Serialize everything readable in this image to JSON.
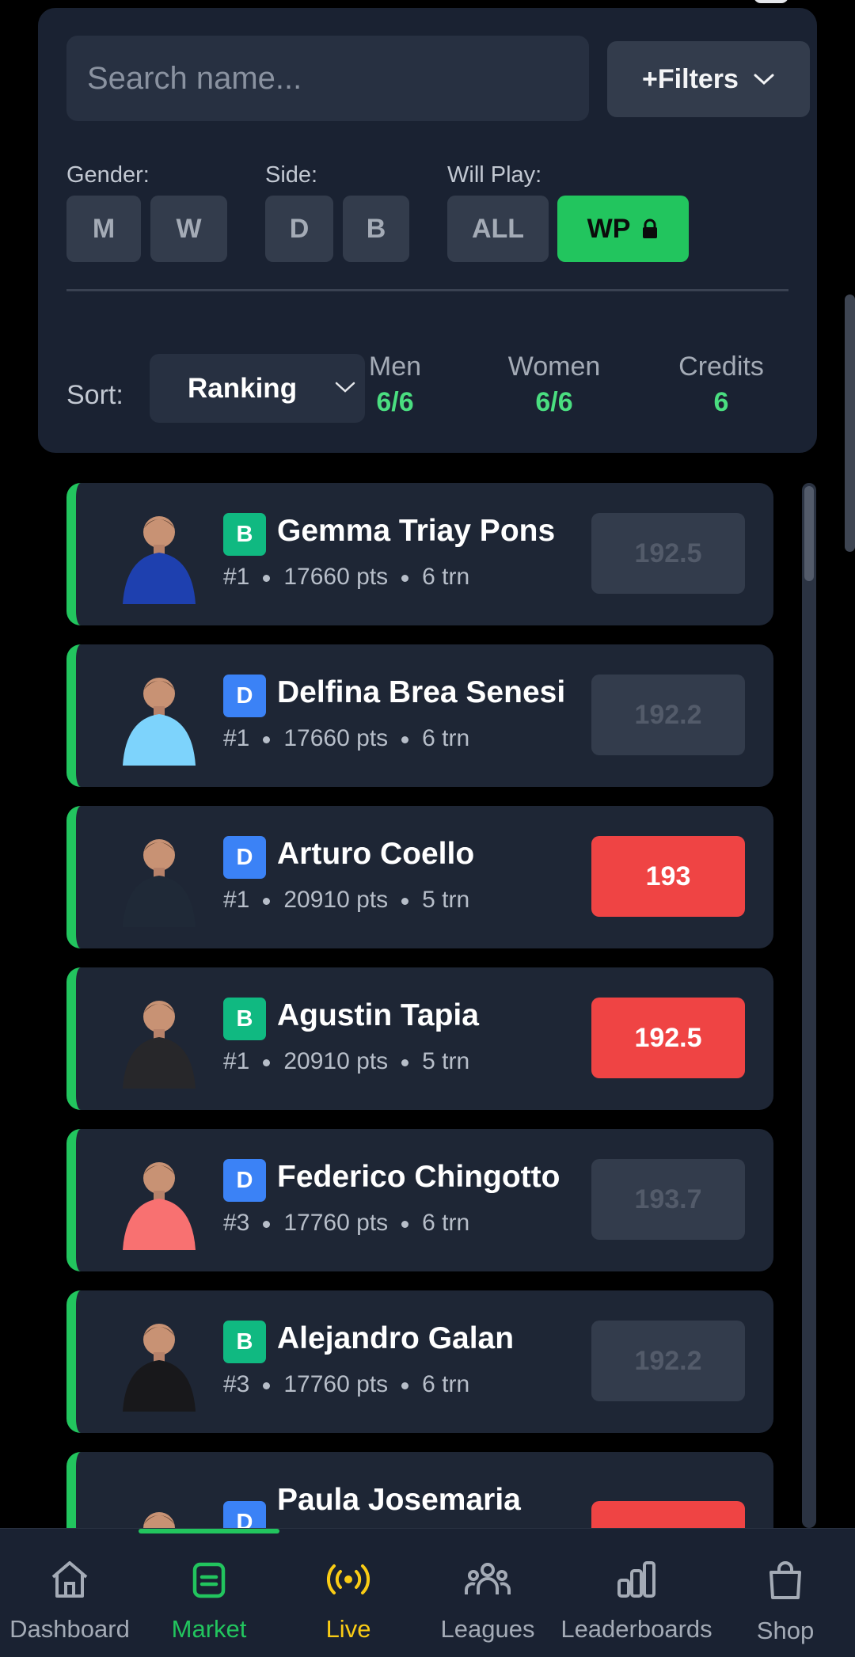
{
  "search": {
    "placeholder": "Search name..."
  },
  "filters_button": {
    "label": "+Filters"
  },
  "gender": {
    "label": "Gender:",
    "options": [
      "M",
      "W"
    ]
  },
  "side": {
    "label": "Side:",
    "options": [
      "D",
      "B"
    ]
  },
  "will_play": {
    "label": "Will Play:",
    "options": [
      "ALL",
      "WP"
    ],
    "selected": "WP"
  },
  "sort": {
    "label": "Sort:",
    "value": "Ranking"
  },
  "stats": [
    {
      "label": "Men",
      "value": "6/6"
    },
    {
      "label": "Women",
      "value": "6/6"
    },
    {
      "label": "Credits",
      "value": "6"
    }
  ],
  "players": [
    {
      "side": "B",
      "name": "Gemma Triay Pons",
      "rank": "#1",
      "points": "17660 pts",
      "tournaments": "6 trn",
      "price": "192.5",
      "price_state": "off",
      "jersey": "#1e40af"
    },
    {
      "side": "D",
      "name": "Delfina Brea Senesi",
      "rank": "#1",
      "points": "17660 pts",
      "tournaments": "6 trn",
      "price": "192.2",
      "price_state": "off",
      "jersey": "#7dd3fc"
    },
    {
      "side": "D",
      "name": "Arturo Coello",
      "rank": "#1",
      "points": "20910 pts",
      "tournaments": "5 trn",
      "price": "193",
      "price_state": "sell",
      "jersey": "#1f2937"
    },
    {
      "side": "B",
      "name": "Agustin Tapia",
      "rank": "#1",
      "points": "20910 pts",
      "tournaments": "5 trn",
      "price": "192.5",
      "price_state": "sell",
      "jersey": "#27272a"
    },
    {
      "side": "D",
      "name": "Federico Chingotto",
      "rank": "#3",
      "points": "17760 pts",
      "tournaments": "6 trn",
      "price": "193.7",
      "price_state": "off",
      "jersey": "#f87171"
    },
    {
      "side": "B",
      "name": "Alejandro Galan",
      "rank": "#3",
      "points": "17760 pts",
      "tournaments": "6 trn",
      "price": "192.2",
      "price_state": "off",
      "jersey": "#18181b"
    },
    {
      "side": "D",
      "name": "Paula Josemaria",
      "rank": "",
      "points": "",
      "tournaments": "",
      "price": "",
      "price_state": "sell",
      "jersey": "#1e3a8a"
    }
  ],
  "nav": {
    "dashboard": "Dashboard",
    "market": "Market",
    "live": "Live",
    "leagues": "Leagues",
    "leaderboards": "Leaderboards",
    "shop": "Shop"
  },
  "colors": {
    "accent": "#22c55e",
    "sell": "#ef4444",
    "live": "#facc15",
    "badge_b": "#10b981",
    "badge_d": "#3b82f6"
  }
}
